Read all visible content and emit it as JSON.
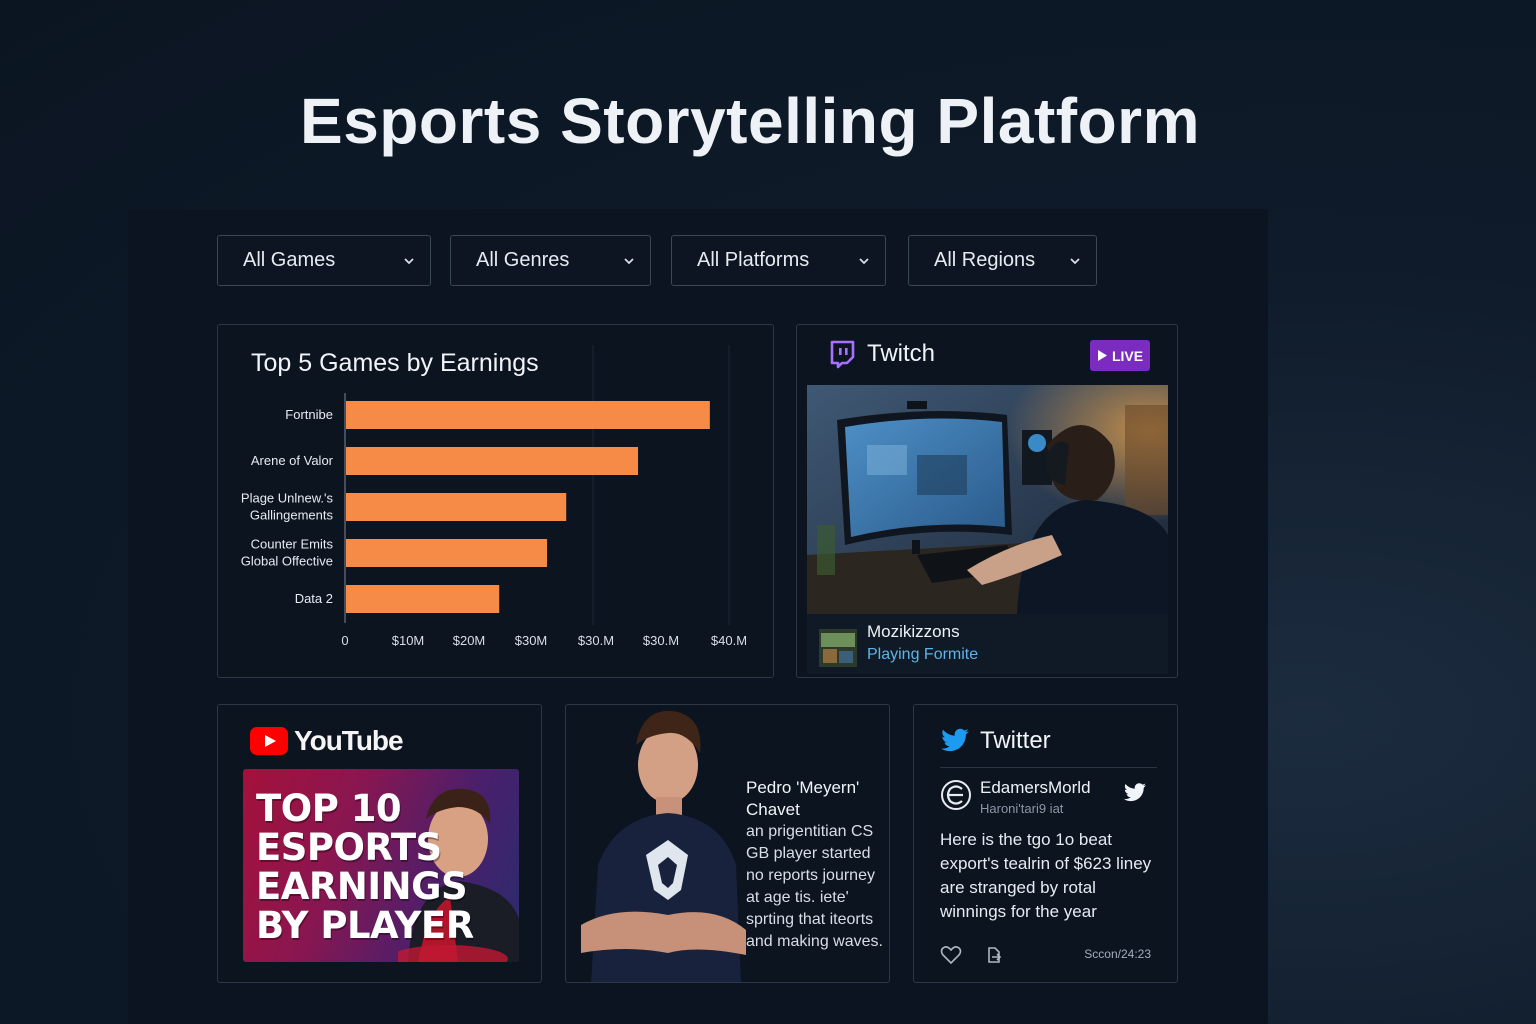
{
  "page": {
    "title": "Esports Storytelling Platform"
  },
  "filters": [
    {
      "label": "All Games"
    },
    {
      "label": "All Genres"
    },
    {
      "label": "All Platforms"
    },
    {
      "label": "All Regions"
    }
  ],
  "chart": {
    "title": "Top 5 Games by Earnings"
  },
  "chart_data": {
    "type": "bar",
    "orientation": "horizontal",
    "title": "Top 5 Games by Earnings",
    "categories": [
      "Fortnibe",
      "Arene of Valor",
      "Plage Unlnew.'s Gallingements",
      "Counter Emits Global Offective",
      "Data 2"
    ],
    "values": [
      38,
      30.5,
      23,
      21,
      16
    ],
    "x_tick_labels": [
      "0",
      "$10M",
      "$20M",
      "$30M",
      "$30.M",
      "$30.M",
      "$40.M"
    ],
    "color": "#f58b47",
    "xlim": [
      0,
      40
    ]
  },
  "twitch": {
    "label": "Twitch",
    "live_label": "LIVE",
    "streamer": "Mozikizzons",
    "playing": "Playing Formite",
    "accent": "#9146ff"
  },
  "youtube": {
    "label": "YouTube",
    "thumb_text": "TOP 10\nESPORTS\nEARNINGS\nBY PLAYER"
  },
  "profile": {
    "name": "Pedro 'Meyern' Chavet",
    "bio": "an prigentitian CS GB player started no reports journey at age tis. iete' sprting that iteorts and making waves."
  },
  "twitter": {
    "label": "Twitter",
    "user": "EdamersMorld",
    "handle": "Haroni'tari9 iat",
    "text": "Here is the tgo 1o beat export's tealrin of $623 liney are stranged by rotal winnings for the year",
    "time": "Sccon/24:23",
    "accent": "#1d9bf0"
  }
}
